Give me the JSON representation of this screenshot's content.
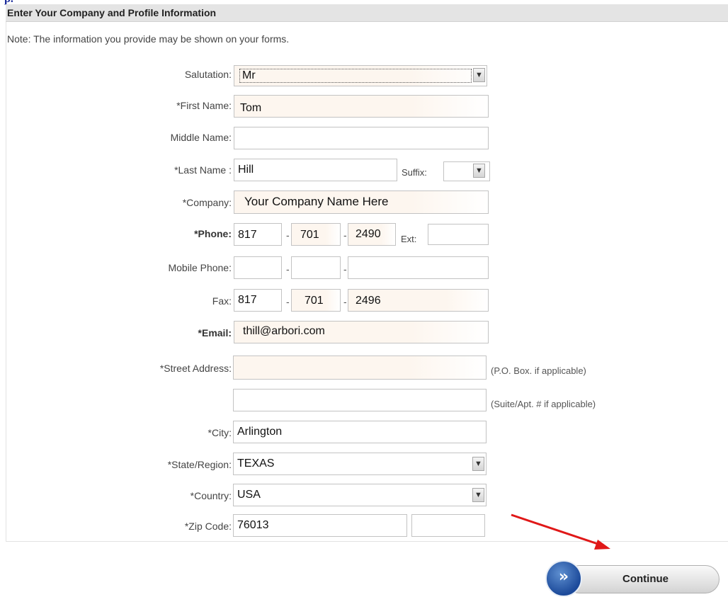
{
  "page": {
    "top_fragment": "p.",
    "header": "Enter Your Company and Profile Information",
    "note": "Note: The information you provide may be shown on your forms."
  },
  "colors": {
    "arrow": "#e01818",
    "button_circle": "#1c4a9a",
    "field_tint": "#fdf6ef"
  },
  "form": {
    "salutation": {
      "label": "Salutation:",
      "value": "Mr"
    },
    "first_name": {
      "label": "*First Name:",
      "value": "Tom"
    },
    "middle_name": {
      "label": "Middle Name:",
      "value": ""
    },
    "last_name": {
      "label": "*Last Name :",
      "value": "Hill"
    },
    "suffix": {
      "label": "Suffix:",
      "value": ""
    },
    "company": {
      "label": "*Company:",
      "value": "Your Company Name Here"
    },
    "phone": {
      "label": "*Phone:",
      "area": "817",
      "prefix": "701",
      "line": "2490",
      "ext_label": "Ext:",
      "ext": ""
    },
    "mobile_phone": {
      "label": "Mobile Phone:",
      "area": "",
      "prefix": "",
      "line": ""
    },
    "fax": {
      "label": "Fax:",
      "area": "817",
      "prefix": "701",
      "line": "2496"
    },
    "email": {
      "label": "*Email:",
      "value": "thill@arbori.com"
    },
    "street_address": {
      "label": "*Street Address:",
      "value": "",
      "hint": "(P.O. Box.  if applicable)"
    },
    "street_address_2": {
      "value": "",
      "hint": "(Suite/Apt. # if applicable)"
    },
    "city": {
      "label": "*City:",
      "value": "Arlington"
    },
    "state": {
      "label": "*State/Region:",
      "value": "TEXAS"
    },
    "country": {
      "label": "*Country:",
      "value": "USA"
    },
    "zip": {
      "label": "*Zip Code:",
      "value": "76013",
      "ext_value": ""
    }
  },
  "buttons": {
    "continue": "Continue",
    "continue_icon": "double-chevron-right-icon"
  }
}
